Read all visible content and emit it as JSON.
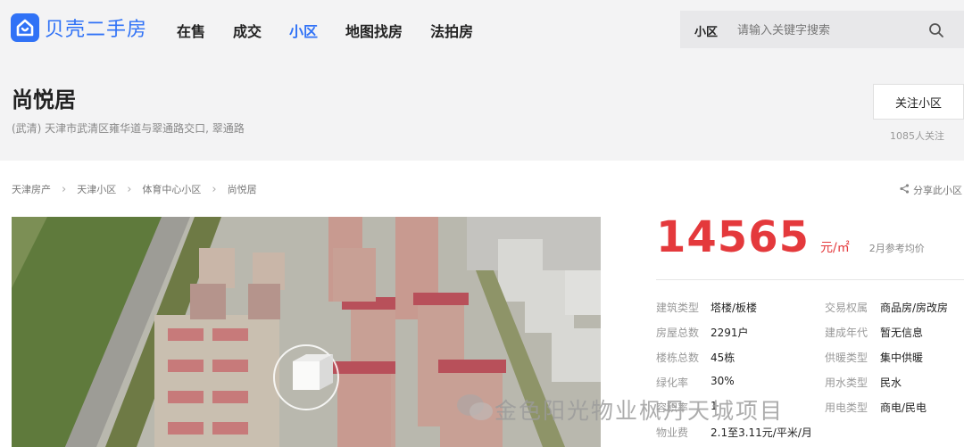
{
  "brand": {
    "name": "贝壳二手房"
  },
  "nav": [
    {
      "label": "在售",
      "active": false
    },
    {
      "label": "成交",
      "active": false
    },
    {
      "label": "小区",
      "active": true
    },
    {
      "label": "地图找房",
      "active": false
    },
    {
      "label": "法拍房",
      "active": false
    }
  ],
  "search": {
    "scope": "小区",
    "placeholder": "请输入关键字搜索"
  },
  "community": {
    "name": "尚悦居",
    "address": "(武清) 天津市武清区雍华道与翠通路交口, 翠通路",
    "follow_label": "关注小区",
    "follow_count": "1085人关注"
  },
  "breadcrumb": [
    "天津房产",
    "天津小区",
    "体育中心小区",
    "尚悦居"
  ],
  "share_label": "分享此小区",
  "price": {
    "value": "14565",
    "unit": "元/㎡",
    "note": "2月参考均价"
  },
  "info_left": [
    {
      "k": "建筑类型",
      "v": "塔楼/板楼"
    },
    {
      "k": "房屋总数",
      "v": "2291户"
    },
    {
      "k": "楼栋总数",
      "v": "45栋"
    },
    {
      "k": "绿化率",
      "v": "30%"
    },
    {
      "k": "容积率",
      "v": "1"
    },
    {
      "k": "物业费",
      "v": "2.1至3.11元/平米/月"
    }
  ],
  "info_right": [
    {
      "k": "交易权属",
      "v": "商品房/房改房"
    },
    {
      "k": "建成年代",
      "v": "暂无信息"
    },
    {
      "k": "供暖类型",
      "v": "集中供暖"
    },
    {
      "k": "用水类型",
      "v": "民水"
    },
    {
      "k": "用电类型",
      "v": "商电/民电"
    }
  ],
  "watermark": "金色阳光物业枫丹天城项目",
  "colors": {
    "accent": "#3072f6",
    "price": "#e4393c"
  }
}
